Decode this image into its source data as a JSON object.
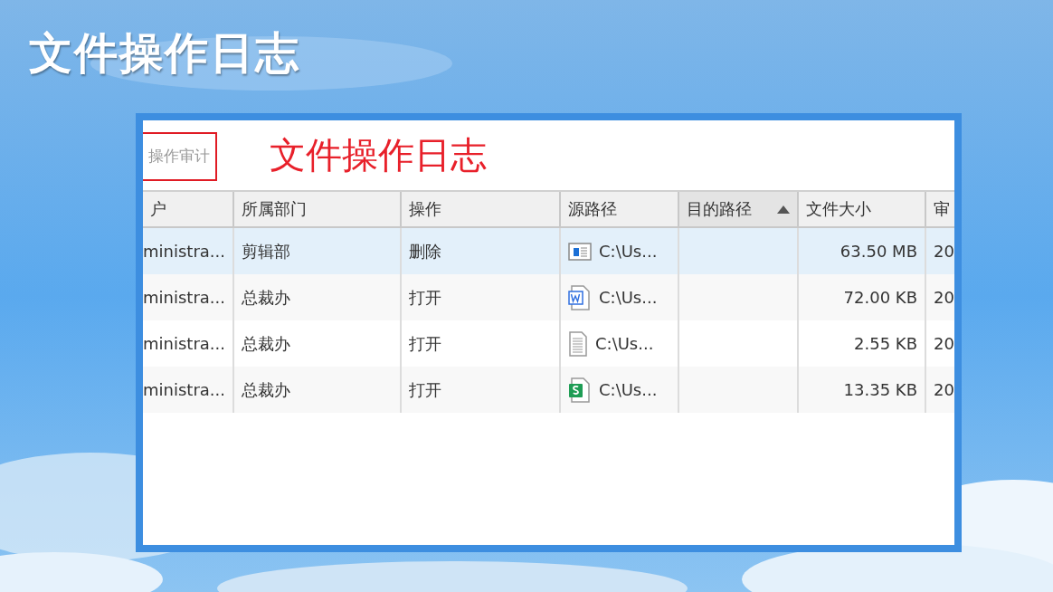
{
  "slide_title": "文件操作日志",
  "window": {
    "tab": "操作审计",
    "heading": "文件操作日志"
  },
  "table": {
    "columns": [
      {
        "label": "户",
        "sorted": false
      },
      {
        "label": "所属部门",
        "sorted": false
      },
      {
        "label": "操作",
        "sorted": false
      },
      {
        "label": "源路径",
        "sorted": false
      },
      {
        "label": "目的路径",
        "sorted": true
      },
      {
        "label": "文件大小",
        "sorted": false
      },
      {
        "label": "审",
        "sorted": false
      }
    ],
    "rows": [
      {
        "selected": true,
        "user": "ministra...",
        "dept": "剪辑部",
        "action": "删除",
        "kind": "video",
        "source": "C:\\Us...",
        "size": "63.50 MB",
        "col7": "20"
      },
      {
        "selected": false,
        "user": "ministra...",
        "dept": "总裁办",
        "action": "打开",
        "kind": "word",
        "source": "C:\\Us...",
        "size": "72.00 KB",
        "col7": "20"
      },
      {
        "selected": false,
        "user": "ministra...",
        "dept": "总裁办",
        "action": "打开",
        "kind": "text",
        "source": "C:\\Us...",
        "size": "2.55 KB",
        "col7": "20"
      },
      {
        "selected": false,
        "user": "ministra...",
        "dept": "总裁办",
        "action": "打开",
        "kind": "sheet",
        "source": "C:\\Us...",
        "size": "13.35 KB",
        "col7": "20"
      }
    ]
  }
}
